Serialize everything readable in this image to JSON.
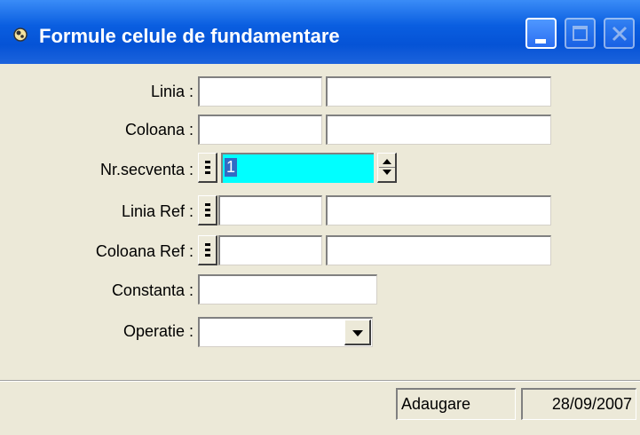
{
  "window": {
    "title": "Formule celule de fundamentare",
    "icon": "app-icon",
    "buttons": {
      "minimize": "minimize-icon",
      "maximize": "maximize-icon",
      "close": "close-icon"
    }
  },
  "form": {
    "linia_label": "Linia :",
    "coloana_label": "Coloana :",
    "nr_secventa_label": "Nr.secventa :",
    "nr_secventa_value": "1",
    "linia_ref_label": "Linia Ref :",
    "coloana_ref_label": "Coloana Ref :",
    "constanta_label": "Constanta :",
    "operatie_label": "Operatie :",
    "operatie_value": "",
    "highlight_color": "#00ffff"
  },
  "status": {
    "mode": "Adaugare",
    "date": "28/09/2007"
  }
}
